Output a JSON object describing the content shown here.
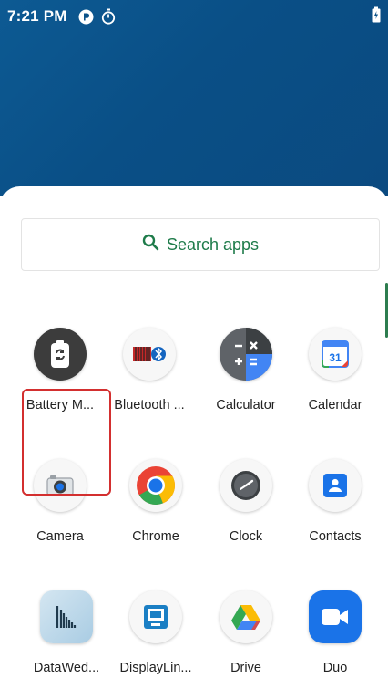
{
  "status_bar": {
    "time": "7:21 PM",
    "icons": [
      "data-sync-icon",
      "stopwatch-icon",
      "battery-charging-icon"
    ]
  },
  "drawer": {
    "search": {
      "label": "Search apps"
    },
    "apps": [
      {
        "label": "Battery M...",
        "icon": "battery-manager-icon"
      },
      {
        "label": "Bluetooth ...",
        "icon": "bluetooth-pairing-icon"
      },
      {
        "label": "Calculator",
        "icon": "calculator-icon"
      },
      {
        "label": "Calendar",
        "icon": "calendar-icon"
      },
      {
        "label": "Camera",
        "icon": "camera-icon"
      },
      {
        "label": "Chrome",
        "icon": "chrome-icon"
      },
      {
        "label": "Clock",
        "icon": "clock-icon"
      },
      {
        "label": "Contacts",
        "icon": "contacts-icon"
      },
      {
        "label": "DataWed...",
        "icon": "datawedge-icon"
      },
      {
        "label": "DisplayLin...",
        "icon": "displaylink-icon"
      },
      {
        "label": "Drive",
        "icon": "drive-icon"
      },
      {
        "label": "Duo",
        "icon": "duo-icon"
      }
    ],
    "calendar_day": "31"
  },
  "colors": {
    "wallpaper": "#0b5289",
    "search_accent": "#1e7b4a",
    "highlight": "#d32f2f"
  }
}
